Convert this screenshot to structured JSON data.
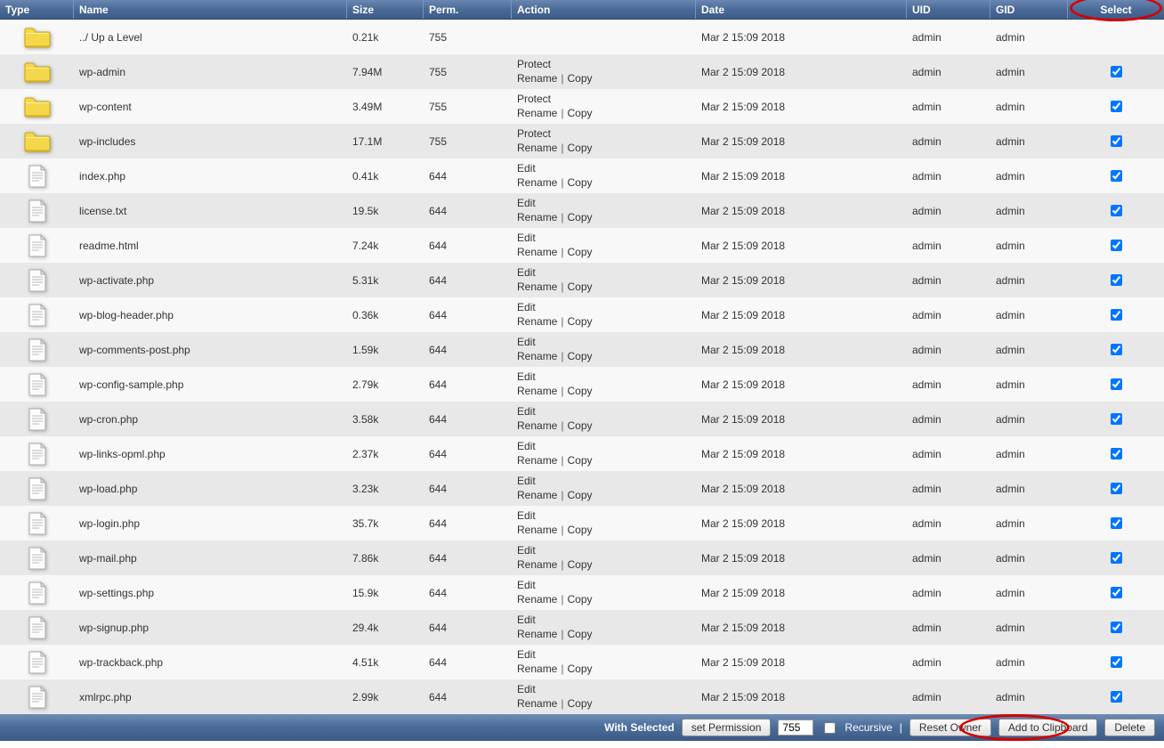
{
  "columns": {
    "type": "Type",
    "name": "Name",
    "size": "Size",
    "perm": "Perm.",
    "action": "Action",
    "date": "Date",
    "uid": "UID",
    "gid": "GID",
    "select": "Select"
  },
  "actions": {
    "protect": "Protect",
    "edit": "Edit",
    "rename": "Rename",
    "copy": "Copy"
  },
  "footer": {
    "with_selected": "With Selected",
    "set_permission": "set Permission",
    "perm_value": "755",
    "recursive": "Recursive",
    "reset_owner": "Reset Owner",
    "add_to_clipboard": "Add to Clipboard",
    "delete": "Delete"
  },
  "rows": [
    {
      "kind": "up",
      "name": "../ Up a Level",
      "size": "0.21k",
      "perm": "755",
      "date": "Mar 2 15:09 2018",
      "uid": "admin",
      "gid": "admin",
      "checked": false
    },
    {
      "kind": "folder",
      "name": "wp-admin",
      "size": "7.94M",
      "perm": "755",
      "date": "Mar 2 15:09 2018",
      "uid": "admin",
      "gid": "admin",
      "checked": true,
      "protect": true
    },
    {
      "kind": "folder",
      "name": "wp-content",
      "size": "3.49M",
      "perm": "755",
      "date": "Mar 2 15:09 2018",
      "uid": "admin",
      "gid": "admin",
      "checked": true,
      "protect": true
    },
    {
      "kind": "folder",
      "name": "wp-includes",
      "size": "17.1M",
      "perm": "755",
      "date": "Mar 2 15:09 2018",
      "uid": "admin",
      "gid": "admin",
      "checked": true,
      "protect": true
    },
    {
      "kind": "file",
      "name": "index.php",
      "size": "0.41k",
      "perm": "644",
      "date": "Mar 2 15:09 2018",
      "uid": "admin",
      "gid": "admin",
      "checked": true
    },
    {
      "kind": "file",
      "name": "license.txt",
      "size": "19.5k",
      "perm": "644",
      "date": "Mar 2 15:09 2018",
      "uid": "admin",
      "gid": "admin",
      "checked": true
    },
    {
      "kind": "file",
      "name": "readme.html",
      "size": "7.24k",
      "perm": "644",
      "date": "Mar 2 15:09 2018",
      "uid": "admin",
      "gid": "admin",
      "checked": true
    },
    {
      "kind": "file",
      "name": "wp-activate.php",
      "size": "5.31k",
      "perm": "644",
      "date": "Mar 2 15:09 2018",
      "uid": "admin",
      "gid": "admin",
      "checked": true
    },
    {
      "kind": "file",
      "name": "wp-blog-header.php",
      "size": "0.36k",
      "perm": "644",
      "date": "Mar 2 15:09 2018",
      "uid": "admin",
      "gid": "admin",
      "checked": true
    },
    {
      "kind": "file",
      "name": "wp-comments-post.php",
      "size": "1.59k",
      "perm": "644",
      "date": "Mar 2 15:09 2018",
      "uid": "admin",
      "gid": "admin",
      "checked": true
    },
    {
      "kind": "file",
      "name": "wp-config-sample.php",
      "size": "2.79k",
      "perm": "644",
      "date": "Mar 2 15:09 2018",
      "uid": "admin",
      "gid": "admin",
      "checked": true
    },
    {
      "kind": "file",
      "name": "wp-cron.php",
      "size": "3.58k",
      "perm": "644",
      "date": "Mar 2 15:09 2018",
      "uid": "admin",
      "gid": "admin",
      "checked": true
    },
    {
      "kind": "file",
      "name": "wp-links-opml.php",
      "size": "2.37k",
      "perm": "644",
      "date": "Mar 2 15:09 2018",
      "uid": "admin",
      "gid": "admin",
      "checked": true
    },
    {
      "kind": "file",
      "name": "wp-load.php",
      "size": "3.23k",
      "perm": "644",
      "date": "Mar 2 15:09 2018",
      "uid": "admin",
      "gid": "admin",
      "checked": true
    },
    {
      "kind": "file",
      "name": "wp-login.php",
      "size": "35.7k",
      "perm": "644",
      "date": "Mar 2 15:09 2018",
      "uid": "admin",
      "gid": "admin",
      "checked": true
    },
    {
      "kind": "file",
      "name": "wp-mail.php",
      "size": "7.86k",
      "perm": "644",
      "date": "Mar 2 15:09 2018",
      "uid": "admin",
      "gid": "admin",
      "checked": true
    },
    {
      "kind": "file",
      "name": "wp-settings.php",
      "size": "15.9k",
      "perm": "644",
      "date": "Mar 2 15:09 2018",
      "uid": "admin",
      "gid": "admin",
      "checked": true
    },
    {
      "kind": "file",
      "name": "wp-signup.php",
      "size": "29.4k",
      "perm": "644",
      "date": "Mar 2 15:09 2018",
      "uid": "admin",
      "gid": "admin",
      "checked": true
    },
    {
      "kind": "file",
      "name": "wp-trackback.php",
      "size": "4.51k",
      "perm": "644",
      "date": "Mar 2 15:09 2018",
      "uid": "admin",
      "gid": "admin",
      "checked": true
    },
    {
      "kind": "file",
      "name": "xmlrpc.php",
      "size": "2.99k",
      "perm": "644",
      "date": "Mar 2 15:09 2018",
      "uid": "admin",
      "gid": "admin",
      "checked": true
    }
  ]
}
